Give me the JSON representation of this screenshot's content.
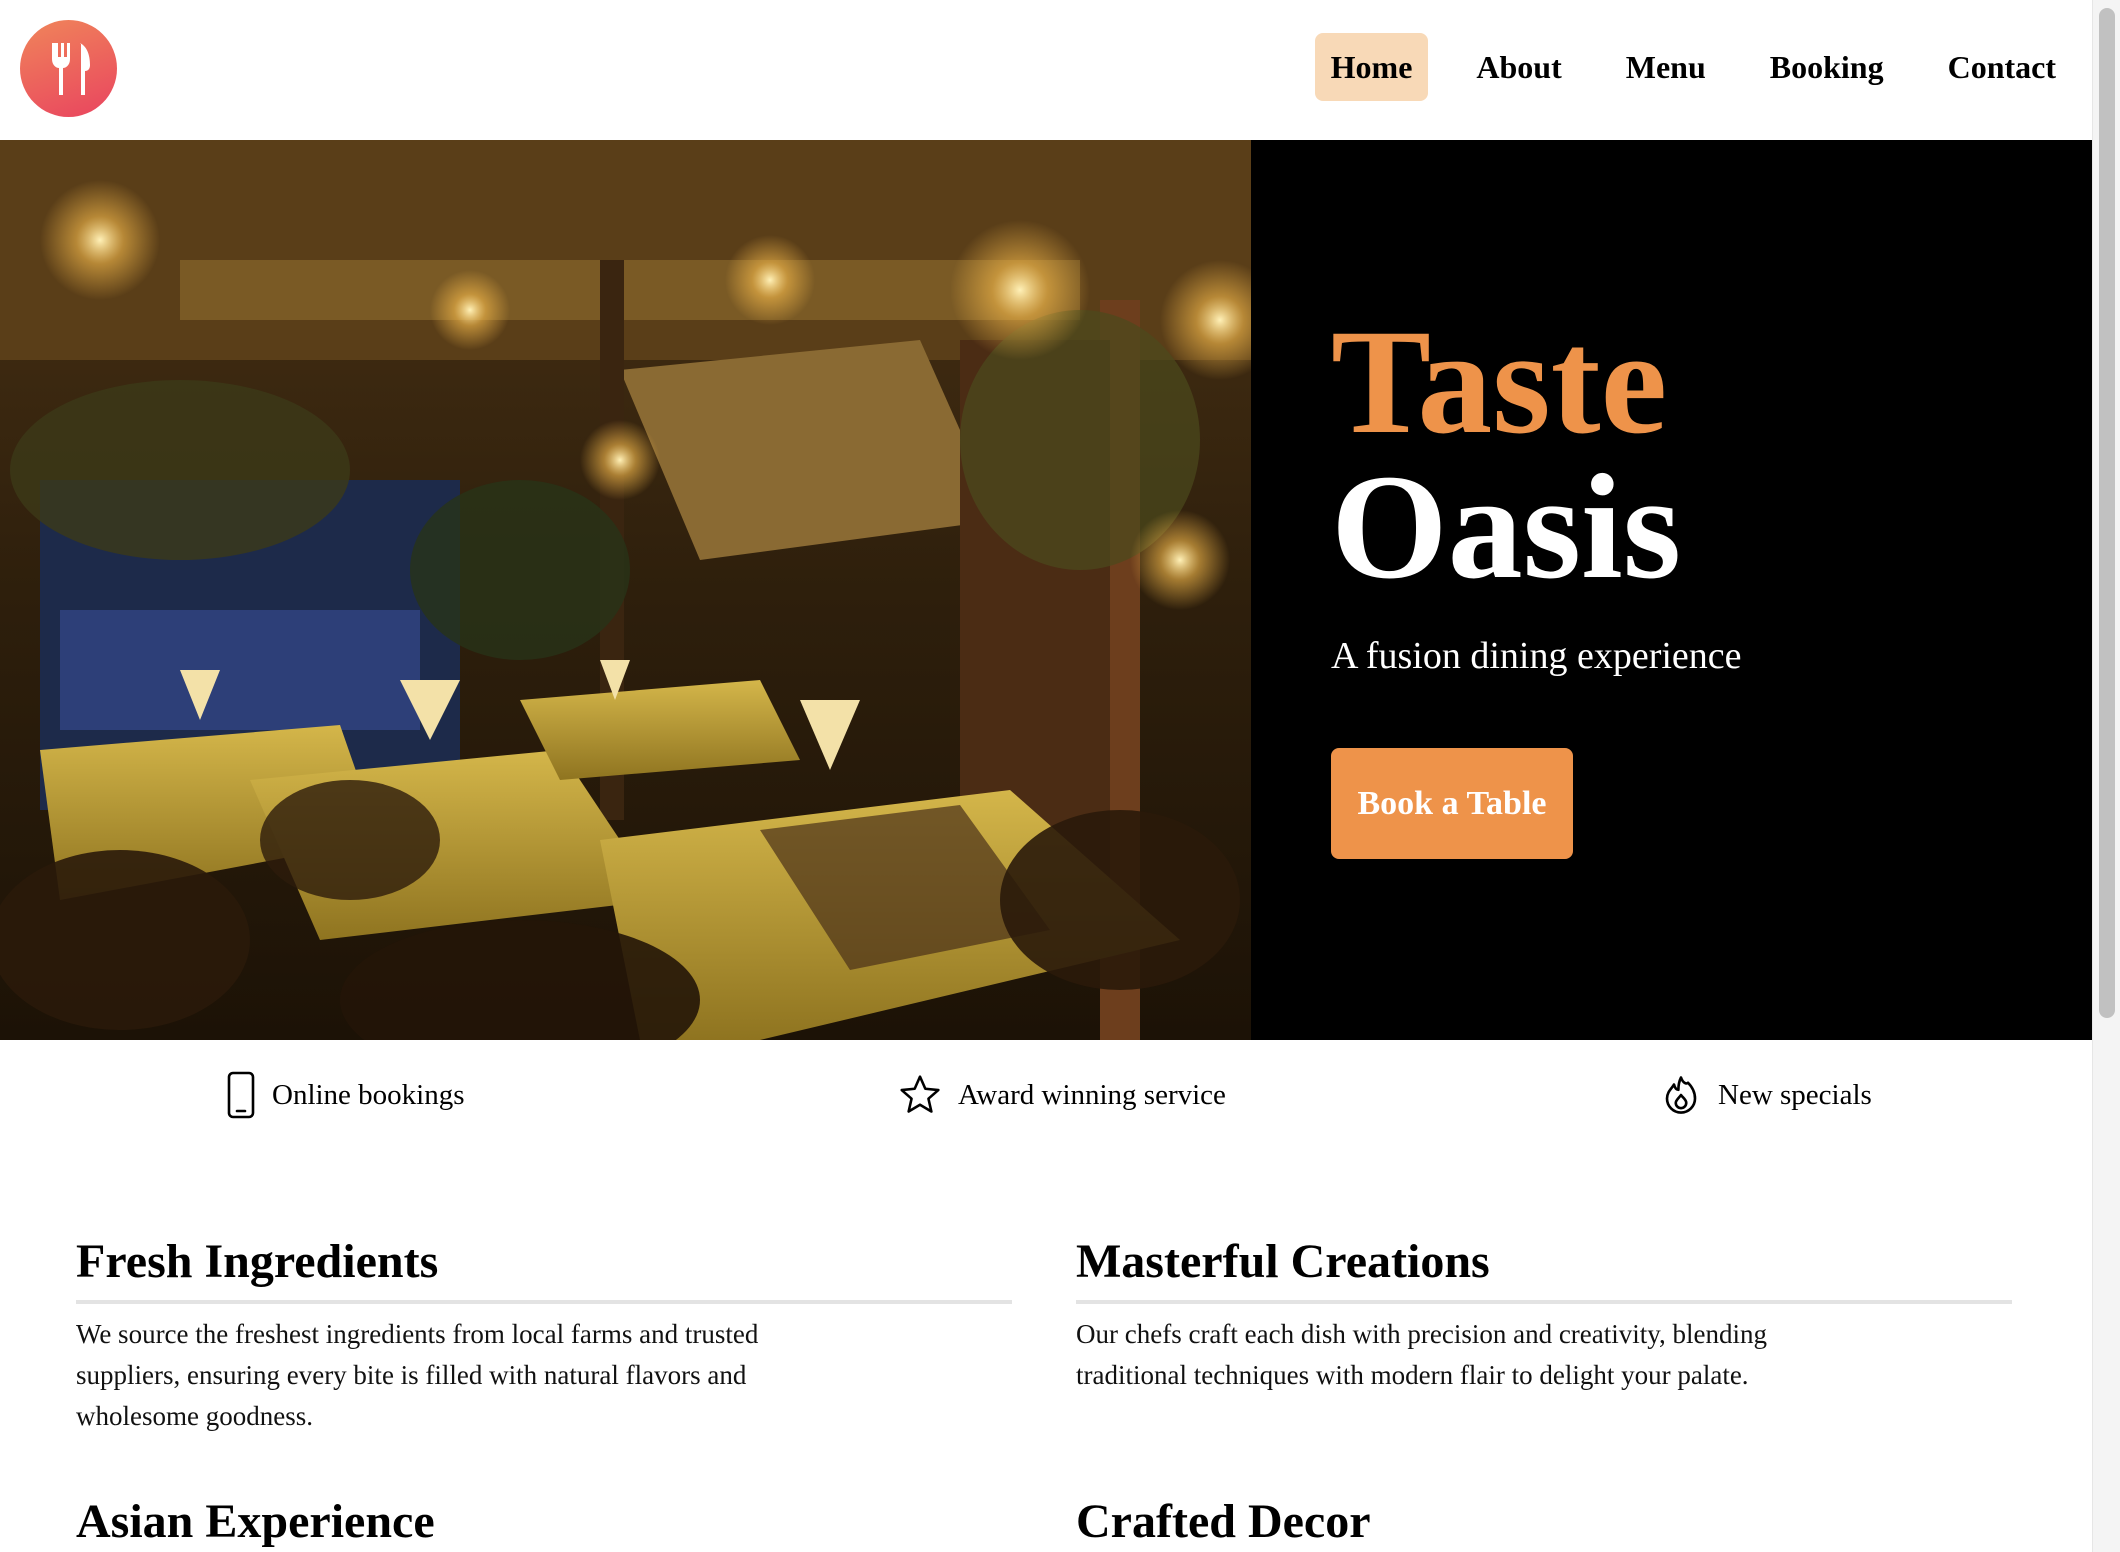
{
  "header": {
    "logo_icon": "fork-spoon-icon",
    "nav": [
      {
        "label": "Home",
        "active": true
      },
      {
        "label": "About",
        "active": false
      },
      {
        "label": "Menu",
        "active": false
      },
      {
        "label": "Booking",
        "active": false
      },
      {
        "label": "Contact",
        "active": false
      }
    ]
  },
  "hero": {
    "title_line1": "Taste",
    "title_line2": "Oasis",
    "tagline": "A fusion dining experience",
    "cta_label": "Book a Table"
  },
  "features": [
    {
      "icon": "smartphone-icon",
      "label": "Online bookings"
    },
    {
      "icon": "star-icon",
      "label": "Award winning service"
    },
    {
      "icon": "flame-icon",
      "label": "New specials"
    }
  ],
  "cards": [
    {
      "title": "Fresh Ingredients",
      "text": "We source the freshest ingredients from local farms and trusted suppliers, ensuring every bite is filled with natural flavors and wholesome goodness."
    },
    {
      "title": "Masterful Creations",
      "text": "Our chefs craft each dish with precision and creativity, blending traditional techniques with modern flair to delight your palate."
    },
    {
      "title": "Asian Experience",
      "text": ""
    },
    {
      "title": "Crafted Decor",
      "text": ""
    }
  ],
  "colors": {
    "accent": "#ee934a",
    "nav_active_bg": "#f8d9b7",
    "logo_gradient_start": "#f0855a",
    "logo_gradient_end": "#e9445f",
    "hero_bg": "#000000"
  }
}
